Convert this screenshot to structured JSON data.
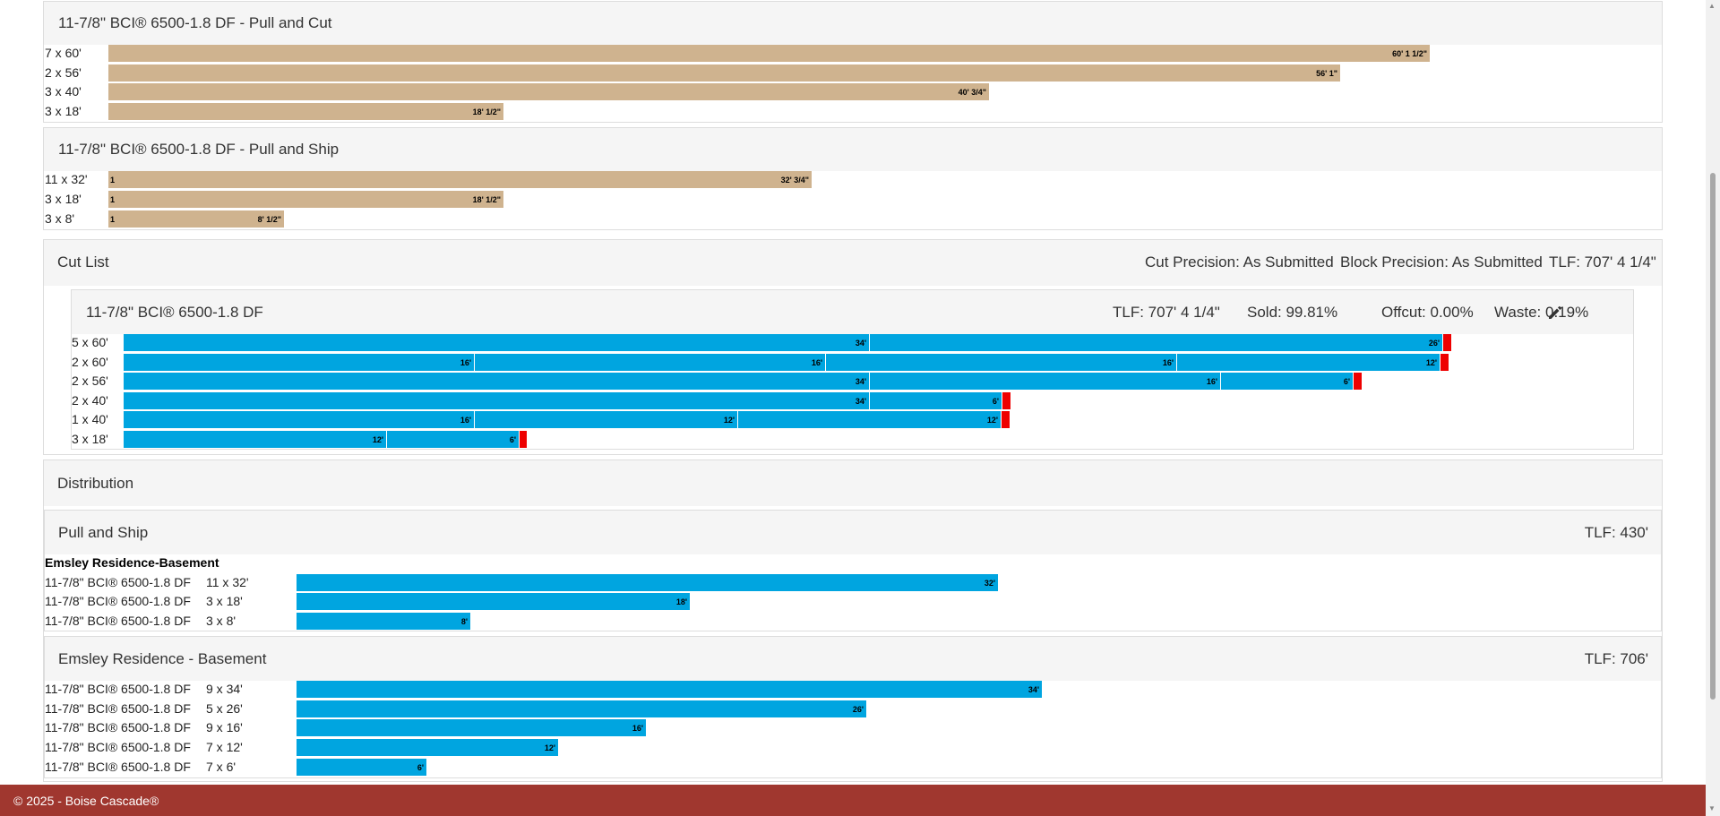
{
  "pull_and_cut": {
    "title": "11-7/8\" BCI® 6500-1.8 DF - Pull and Cut",
    "rows": [
      {
        "label": "7 x 60'",
        "bar": "60' 1 1/2\"",
        "end": 1597
      },
      {
        "label": "2 x 56'",
        "bar": "56' 1\"",
        "end": 1497
      },
      {
        "label": "3 x 40'",
        "bar": "40' 3/4\"",
        "end": 1105
      },
      {
        "label": "3 x 18'",
        "bar": "18' 1/2\"",
        "end": 563
      }
    ]
  },
  "pull_and_ship": {
    "title": "11-7/8\" BCI® 6500-1.8 DF - Pull and Ship",
    "rows": [
      {
        "label": "11 x 32'",
        "qty": "1",
        "bar": "32' 3/4\"",
        "end": 907
      },
      {
        "label": "3 x 18'",
        "qty": "1",
        "bar": "18' 1/2\"",
        "end": 563
      },
      {
        "label": "3 x 8'",
        "qty": "1",
        "bar": "8' 1/2\"",
        "end": 318
      }
    ]
  },
  "cut_list": {
    "title": "Cut List",
    "cut_precision": "Cut Precision: As Submitted",
    "block_precision": "Block Precision: As Submitted",
    "tlf": "TLF: 707' 4 1/4\"",
    "product": {
      "title": "11-7/8\" BCI® 6500-1.8 DF",
      "tlf": "TLF: 707' 4 1/4\"",
      "sold": "Sold: 99.81%",
      "offcut": "Offcut: 0.00%",
      "waste": "Waste: 0.19%",
      "rows": [
        {
          "label": "5 x 60'",
          "segments": [
            "34'",
            "26'"
          ],
          "ends": [
            971,
            1611
          ],
          "waste_end": 1620
        },
        {
          "label": "2 x 60'",
          "segments": [
            "16'",
            "16'",
            "16'",
            "12'"
          ],
          "ends": [
            530,
            922,
            1314,
            1608
          ],
          "waste_end": 1617
        },
        {
          "label": "2 x 56'",
          "segments": [
            "34'",
            "16'",
            "6'"
          ],
          "ends": [
            971,
            1363,
            1511
          ],
          "waste_end": 1520
        },
        {
          "label": "2 x 40'",
          "segments": [
            "34'",
            "6'"
          ],
          "ends": [
            971,
            1119
          ],
          "waste_end": 1128
        },
        {
          "label": "1 x 40'",
          "segments": [
            "16'",
            "12'",
            "12'"
          ],
          "ends": [
            530,
            824,
            1118
          ],
          "waste_end": 1127
        },
        {
          "label": "3 x 18'",
          "segments": [
            "12'",
            "6'"
          ],
          "ends": [
            432,
            580
          ],
          "waste_end": 588
        }
      ]
    }
  },
  "distribution": {
    "title": "Distribution",
    "pull_and_ship": {
      "title": "Pull and Ship",
      "tlf": "TLF: 430'",
      "group": "Emsley Residence-Basement",
      "rows": [
        {
          "product": "11-7/8\" BCI® 6500-1.8 DF",
          "qty": "11 x 32'",
          "bar": "32'",
          "end": 1115
        },
        {
          "product": "11-7/8\" BCI® 6500-1.8 DF",
          "qty": "3 x 18'",
          "bar": "18'",
          "end": 771
        },
        {
          "product": "11-7/8\" BCI® 6500-1.8 DF",
          "qty": "3 x 8'",
          "bar": "8'",
          "end": 526
        }
      ]
    },
    "basement": {
      "title": "Emsley Residence - Basement",
      "tlf": "TLF: 706'",
      "rows": [
        {
          "product": "11-7/8\" BCI® 6500-1.8 DF",
          "qty": "9 x 34'",
          "bar": "34'",
          "end": 1164
        },
        {
          "product": "11-7/8\" BCI® 6500-1.8 DF",
          "qty": "5 x 26'",
          "bar": "26'",
          "end": 968
        },
        {
          "product": "11-7/8\" BCI® 6500-1.8 DF",
          "qty": "9 x 16'",
          "bar": "16'",
          "end": 722
        },
        {
          "product": "11-7/8\" BCI® 6500-1.8 DF",
          "qty": "7 x 12'",
          "bar": "12'",
          "end": 624
        },
        {
          "product": "11-7/8\" BCI® 6500-1.8 DF",
          "qty": "7 x 6'",
          "bar": "6'",
          "end": 477
        }
      ]
    }
  },
  "footer": {
    "text": "© 2025 - Boise Cascade®"
  },
  "colors": {
    "tan": "#cfb38f",
    "blue": "#00a5e0",
    "waste": "#ee0000",
    "footer": "#a0372f"
  },
  "icons": {
    "edit": "pencil-icon"
  }
}
